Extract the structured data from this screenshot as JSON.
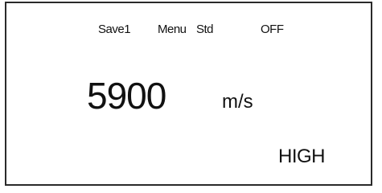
{
  "status_bar": {
    "save_slot": "Save1",
    "menu": "Menu",
    "mode": "Std",
    "power": "OFF"
  },
  "reading": {
    "value": "5900",
    "unit": "m/s"
  },
  "level": "HIGH"
}
